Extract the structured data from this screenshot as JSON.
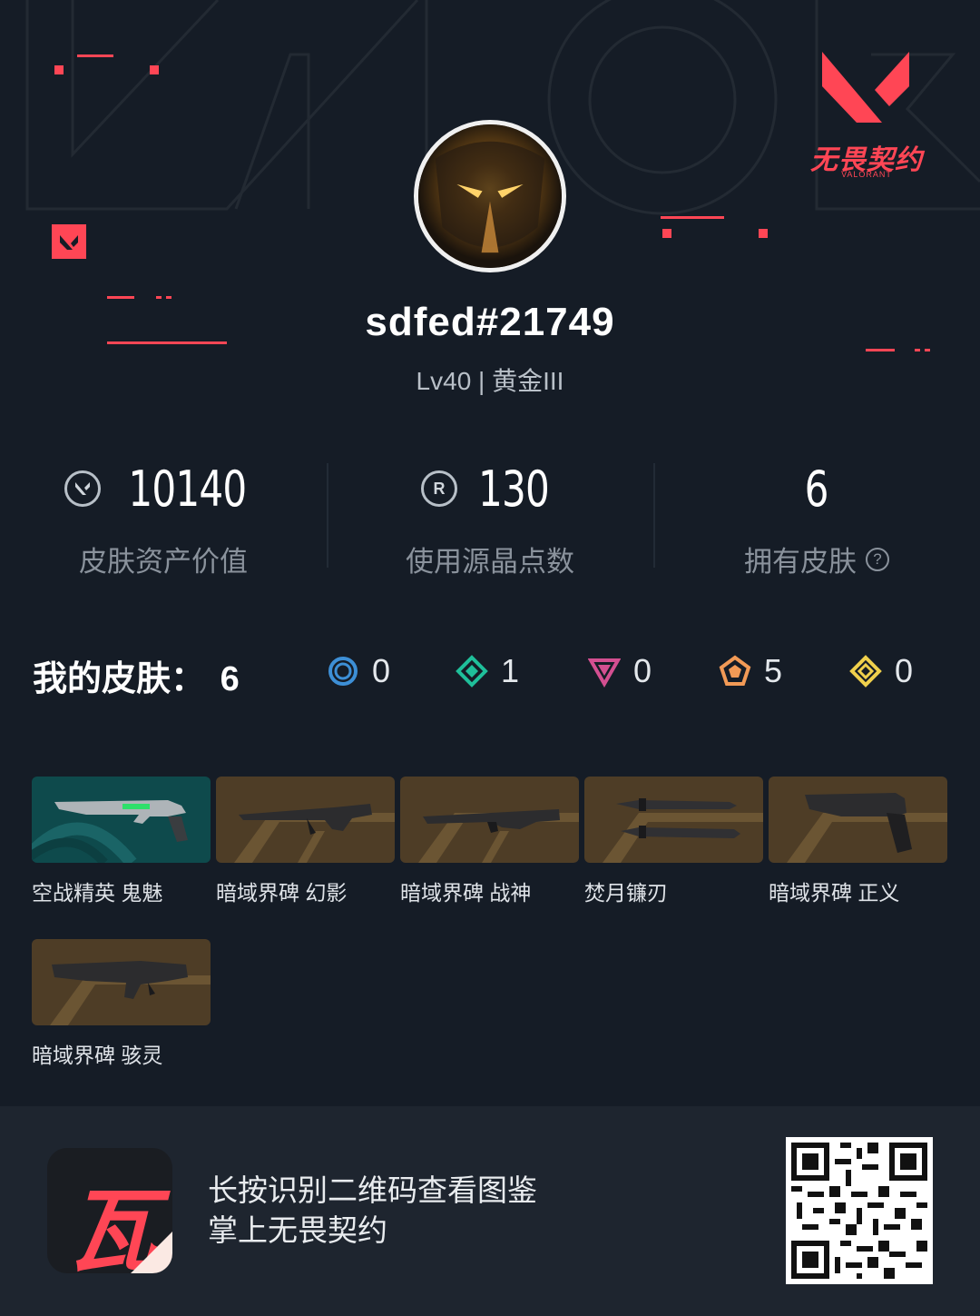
{
  "profile": {
    "username": "sdfed#21749",
    "level_rank": "Lv40 | 黄金III"
  },
  "brand": {
    "name": "无畏契约",
    "sub": "VALORANT"
  },
  "stats": [
    {
      "value": "10140",
      "label": "皮肤资产价值",
      "icon": "valorant-points-icon"
    },
    {
      "value": "130",
      "label": "使用源晶点数",
      "icon": "radianite-icon"
    },
    {
      "value": "6",
      "label": "拥有皮肤",
      "icon": "help-icon"
    }
  ],
  "skins_summary": {
    "title": "我的皮肤：",
    "count": "6",
    "tiers": [
      {
        "icon": "select-tier-icon",
        "count": "0",
        "color": "#3d8fd6"
      },
      {
        "icon": "deluxe-tier-icon",
        "count": "1",
        "color": "#1fbf9a"
      },
      {
        "icon": "premium-tier-icon",
        "count": "0",
        "color": "#d44f91"
      },
      {
        "icon": "ultra-tier-icon",
        "count": "5",
        "color": "#f29a56"
      },
      {
        "icon": "exclusive-tier-icon",
        "count": "0",
        "color": "#f0d04c"
      }
    ]
  },
  "skins": [
    {
      "name": "空战精英 鬼魅",
      "bg": "teal"
    },
    {
      "name": "暗域界碑 幻影",
      "bg": "brown"
    },
    {
      "name": "暗域界碑 战神",
      "bg": "brown"
    },
    {
      "name": "焚月镰刃",
      "bg": "brown"
    },
    {
      "name": "暗域界碑 正义",
      "bg": "brown"
    },
    {
      "name": "暗域界碑 骇灵",
      "bg": "brown"
    }
  ],
  "footer": {
    "line1": "长按识别二维码查看图鉴",
    "line2": "掌上无畏契约",
    "app_glyph": "瓦"
  },
  "colors": {
    "accent": "#ff4655",
    "background": "#151c26",
    "footer_bg": "#1e252f"
  }
}
